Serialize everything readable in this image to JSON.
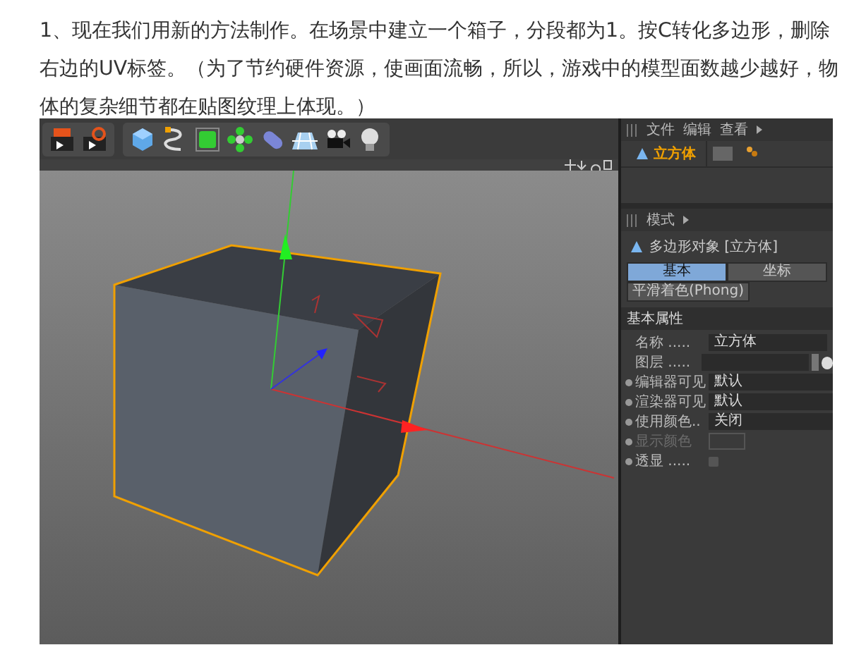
{
  "article": {
    "paragraph": "1、现在我们用新的方法制作。在场景中建立一个箱子，分段都为1。按C转化多边形，删除右边的UV标签。（为了节约硬件资源，使画面流畅，所以，游戏中的模型面数越少越好，物体的复杂细节都在贴图纹理上体现。）"
  },
  "object_manager": {
    "menu": [
      "文件",
      "编辑",
      "查看"
    ],
    "objects": [
      {
        "name": "立方体",
        "selected": true
      }
    ]
  },
  "attribute_manager": {
    "menu": [
      "模式"
    ],
    "title": "多边形对象 [立方体]",
    "tabs": [
      {
        "label": "基本",
        "selected": true
      },
      {
        "label": "坐标",
        "selected": false
      },
      {
        "label": "平滑着色(Phong)",
        "selected": false
      }
    ],
    "section": "基本属性",
    "fields": [
      {
        "kind": "text",
        "label": "名称 .....",
        "value": "立方体",
        "animatable": false,
        "disabled": false
      },
      {
        "kind": "layer",
        "label": "图层 .....",
        "animatable": false,
        "disabled": false
      },
      {
        "kind": "dropdown",
        "label": "编辑器可见",
        "value": "默认",
        "animatable": true,
        "disabled": false
      },
      {
        "kind": "dropdown",
        "label": "渲染器可见",
        "value": "默认",
        "animatable": true,
        "disabled": false
      },
      {
        "kind": "dropdown",
        "label": "使用颜色..",
        "value": "关闭",
        "animatable": true,
        "disabled": false
      },
      {
        "kind": "color",
        "label": "显示颜色",
        "animatable": true,
        "disabled": true
      },
      {
        "kind": "checkbox",
        "label": "透显 .....",
        "checked": false,
        "animatable": true,
        "disabled": false
      }
    ]
  }
}
